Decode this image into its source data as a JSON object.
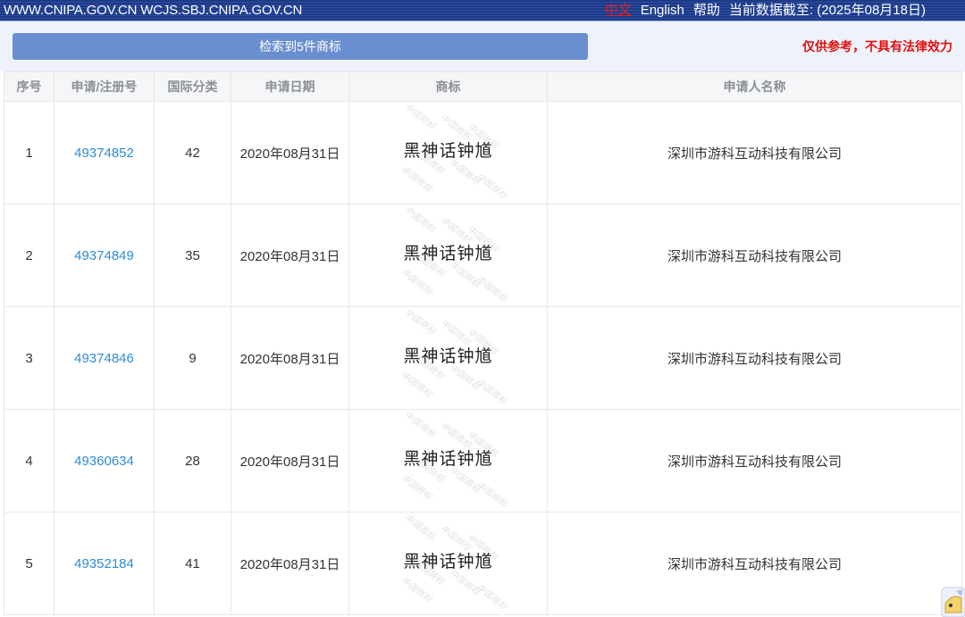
{
  "topbar": {
    "domains": "WWW.CNIPA.GOV.CN WCJS.SBJ.CNIPA.GOV.CN",
    "lang_zh": "中文",
    "lang_en": "English",
    "help": "帮助",
    "data_date": "当前数据截至: (2025年08月18日)"
  },
  "result_count_label": "检索到5件商标",
  "disclaimer": "仅供参考，不具有法律效力",
  "table": {
    "headers": [
      "序号",
      "申请/注册号",
      "国际分类",
      "申请日期",
      "商标",
      "申请人名称"
    ],
    "rows": [
      {
        "index": "1",
        "reg_no": "49374852",
        "class": "42",
        "date": "2020年08月31日",
        "mark": "黑神话钟馗",
        "applicant": "深圳市游科互动科技有限公司"
      },
      {
        "index": "2",
        "reg_no": "49374849",
        "class": "35",
        "date": "2020年08月31日",
        "mark": "黑神话钟馗",
        "applicant": "深圳市游科互动科技有限公司"
      },
      {
        "index": "3",
        "reg_no": "49374846",
        "class": "9",
        "date": "2020年08月31日",
        "mark": "黑神话钟馗",
        "applicant": "深圳市游科互动科技有限公司"
      },
      {
        "index": "4",
        "reg_no": "49360634",
        "class": "28",
        "date": "2020年08月31日",
        "mark": "黑神话钟馗",
        "applicant": "深圳市游科互动科技有限公司"
      },
      {
        "index": "5",
        "reg_no": "49352184",
        "class": "41",
        "date": "2020年08月31日",
        "mark": "黑神话钟馗",
        "applicant": "深圳市游科互动科技有限公司"
      }
    ]
  },
  "watermark_text": "中国商标",
  "colors": {
    "topbar": "#1c3a86",
    "button": "#6a8fd0",
    "link": "#2d8cd8",
    "disclaimer": "#e01010"
  }
}
